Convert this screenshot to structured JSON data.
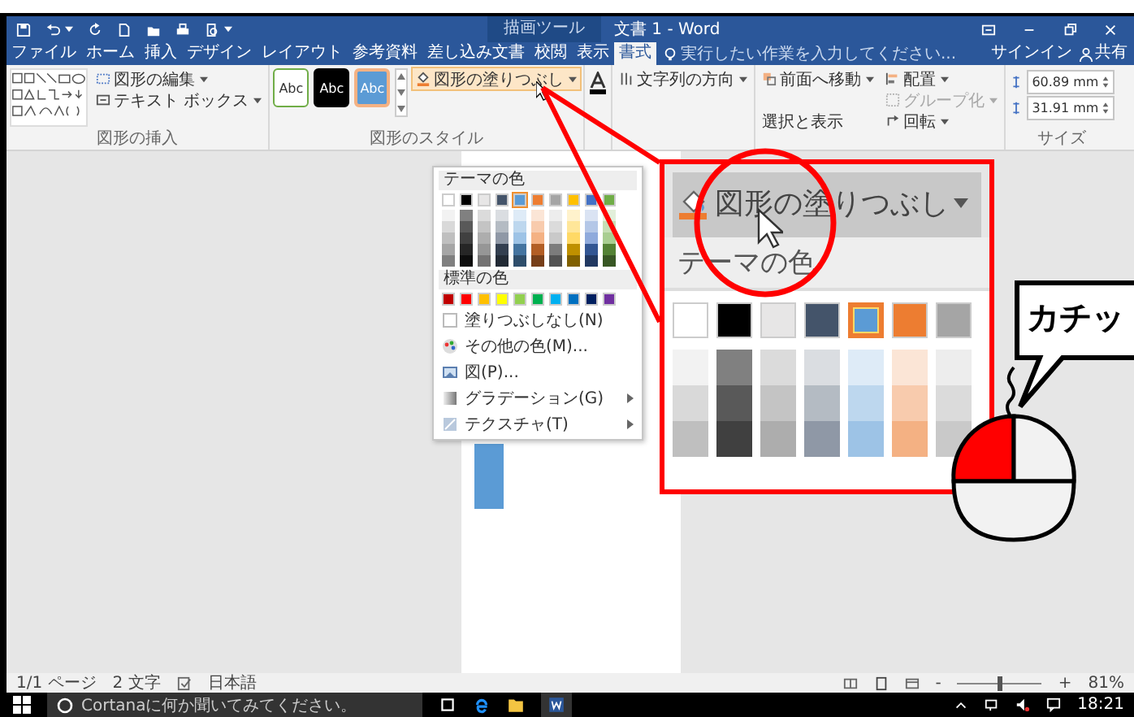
{
  "title_bar": {
    "context_label": "描画ツール",
    "title": "文書 1 - Word"
  },
  "tabs": [
    {
      "label": "ファイル",
      "selected": false
    },
    {
      "label": "ホーム",
      "selected": false
    },
    {
      "label": "挿入",
      "selected": false
    },
    {
      "label": "デザイン",
      "selected": false
    },
    {
      "label": "レイアウト",
      "selected": false
    },
    {
      "label": "参考資料",
      "selected": false
    },
    {
      "label": "差し込み文書",
      "selected": false
    },
    {
      "label": "校閲",
      "selected": false
    },
    {
      "label": "表示",
      "selected": false
    },
    {
      "label": "書式",
      "selected": true
    }
  ],
  "tell_me": {
    "placeholder": "実行したい作業を入力してください..."
  },
  "account": {
    "sign_in": "サインイン",
    "share": "共有"
  },
  "ribbon": {
    "insert_shapes": {
      "label": "図形の挿入",
      "edit_shape": "図形の編集",
      "text_box": "テキスト ボックス"
    },
    "shape_styles": {
      "label": "図形のスタイル",
      "presets": [
        {
          "text": "Abc",
          "kind": "outline"
        },
        {
          "text": "Abc",
          "kind": "dark"
        },
        {
          "text": "Abc",
          "kind": "accent"
        }
      ],
      "fill_button": "図形の塗りつぶし"
    },
    "text": {
      "direction": "文字列の方向"
    },
    "arrange": {
      "bring_forward": "前面へ移動",
      "selection_pane": "選択と表示",
      "align": "配置",
      "group": {
        "label": "グループ化",
        "disabled": true
      },
      "rotate": "回転"
    },
    "size": {
      "label": "サイズ",
      "fields": [
        "60.89 mm",
        "31.91 mm"
      ]
    }
  },
  "fill_menu": {
    "theme_heading": "テーマの色",
    "theme_colors": [
      {
        "color": "#ffffff",
        "selected": false
      },
      {
        "color": "#000000",
        "selected": false
      },
      {
        "color": "#e7e6e6",
        "selected": false
      },
      {
        "color": "#44546a",
        "selected": false
      },
      {
        "color": "#5b9bd5",
        "selected": true
      },
      {
        "color": "#ed7d31",
        "selected": false
      },
      {
        "color": "#a5a5a5",
        "selected": false
      },
      {
        "color": "#ffc000",
        "selected": false
      },
      {
        "color": "#4472c4",
        "selected": false
      },
      {
        "color": "#70ad47",
        "selected": false
      }
    ],
    "standard_heading": "標準の色",
    "standard_colors": [
      {
        "color": "#c00000",
        "selected": false
      },
      {
        "color": "#ff0000",
        "selected": false
      },
      {
        "color": "#ffc000",
        "selected": false
      },
      {
        "color": "#ffff00",
        "selected": false
      },
      {
        "color": "#92d050",
        "selected": false
      },
      {
        "color": "#00b050",
        "selected": false
      },
      {
        "color": "#00b0f0",
        "selected": false
      },
      {
        "color": "#0070c0",
        "selected": false
      },
      {
        "color": "#002060",
        "selected": false
      },
      {
        "color": "#7030a0",
        "selected": false
      }
    ],
    "items": [
      {
        "label": "塗りつぶしなし(N)",
        "kind": "none",
        "submenu": false
      },
      {
        "label": "その他の色(M)...",
        "kind": "palette",
        "submenu": false
      },
      {
        "label": "図(P)...",
        "kind": "picture",
        "submenu": false
      },
      {
        "label": "グラデーション(G)",
        "kind": "gradient",
        "submenu": true
      },
      {
        "label": "テクスチャ(T)",
        "kind": "texture",
        "submenu": true
      }
    ]
  },
  "zoom_callout": {
    "button_label": "図形の塗りつぶし",
    "heading": "テーマの色",
    "swatches": [
      {
        "color": "#ffffff",
        "selected": false
      },
      {
        "color": "#000000",
        "selected": false
      },
      {
        "color": "#e7e6e6",
        "selected": false
      },
      {
        "color": "#44546a",
        "selected": false
      },
      {
        "color": "#5b9bd5",
        "selected": true
      },
      {
        "color": "#ed7d31",
        "selected": false
      },
      {
        "color": "#a5a5a5",
        "selected": false
      }
    ]
  },
  "speech_bubble": {
    "text": "カチッ"
  },
  "status_bar": {
    "page": "1/1 ページ",
    "words": "2 文字",
    "language": "日本語",
    "zoom": {
      "minus": "-",
      "plus": "+",
      "level": 0.5,
      "reading": "81%"
    }
  },
  "taskbar": {
    "search_placeholder": "Cortanaに何か聞いてみてください。",
    "time": "18:21"
  }
}
